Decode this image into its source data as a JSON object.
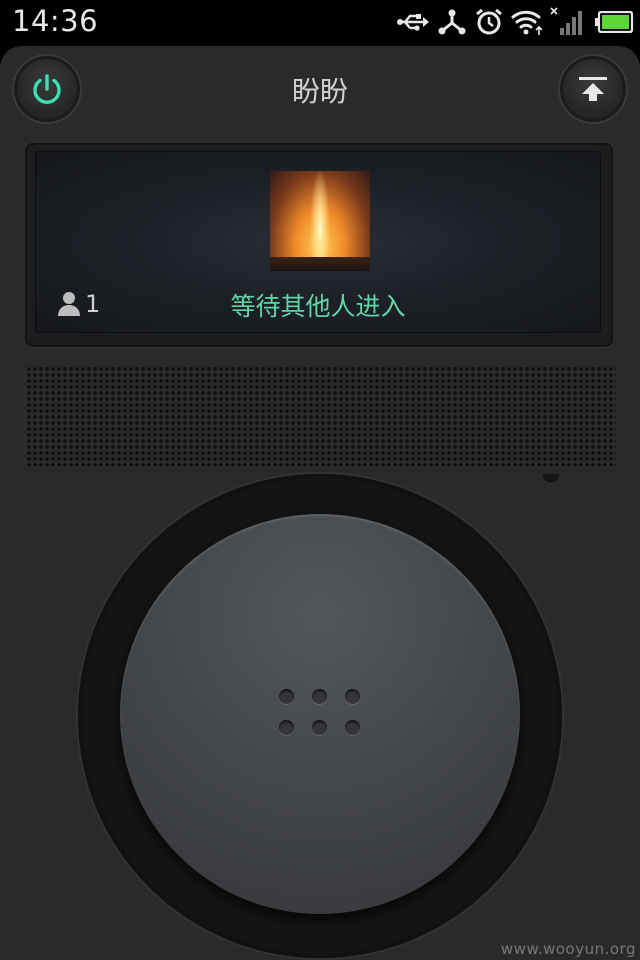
{
  "status_bar": {
    "time": "14:36",
    "icons": [
      "usb-icon",
      "usb-debug-icon",
      "alarm-icon",
      "wifi-icon",
      "signal-icon",
      "battery-icon"
    ]
  },
  "header": {
    "title": "盼盼",
    "left_button": "power-icon",
    "right_button": "upload-icon"
  },
  "display": {
    "participant_count": "1",
    "status": "等待其他人进入",
    "accent_color": "#5fd6a6"
  },
  "dial": {
    "dot_count": 6
  },
  "watermark": "www.wooyun.org"
}
